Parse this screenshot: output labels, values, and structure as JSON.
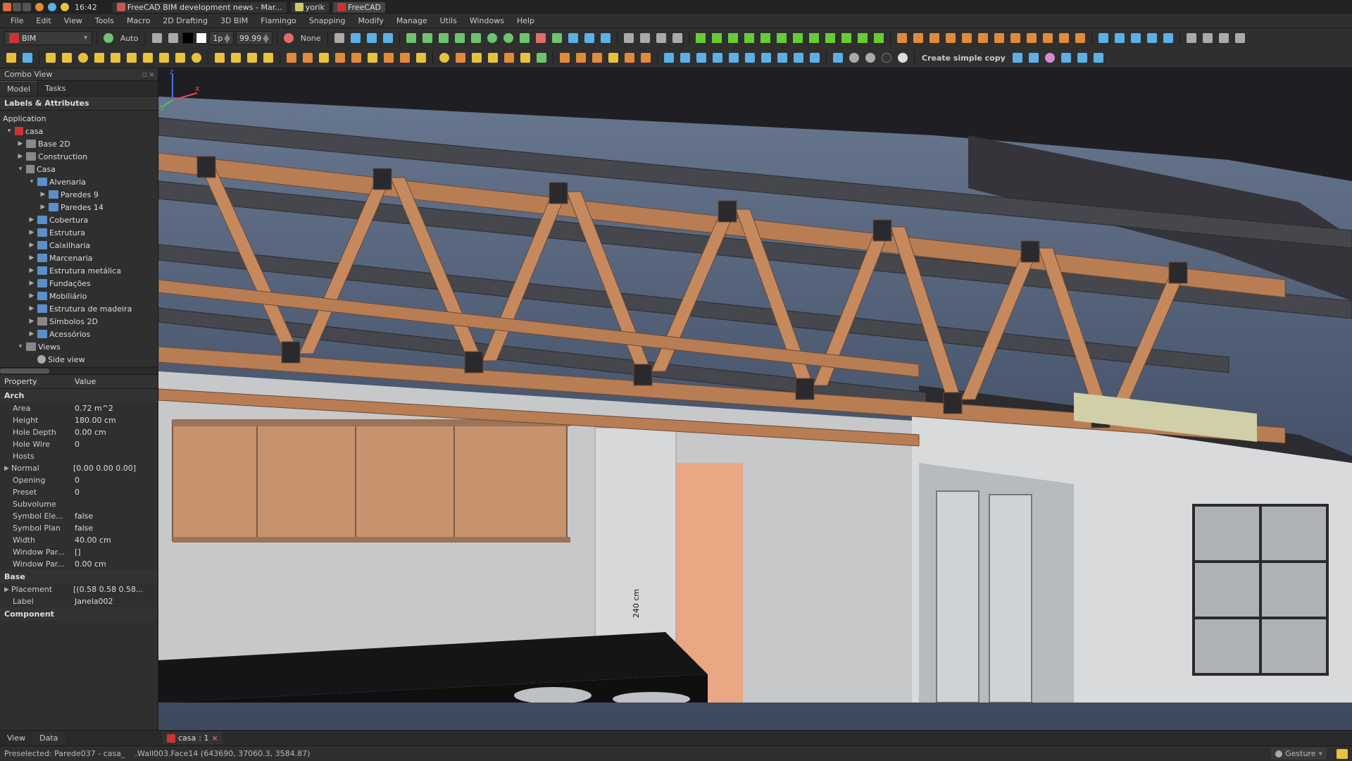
{
  "os": {
    "time": "16:42",
    "tasks": [
      {
        "label": "FreeCAD BIM development news - Mar...",
        "active": false
      },
      {
        "label": "yorik",
        "active": false
      },
      {
        "label": "FreeCAD",
        "active": true
      }
    ]
  },
  "menu": [
    "File",
    "Edit",
    "View",
    "Tools",
    "Macro",
    "2D Drafting",
    "3D BIM",
    "Flamingo",
    "Snapping",
    "Modify",
    "Manage",
    "Utils",
    "Windows",
    "Help"
  ],
  "tb1": {
    "workbench": "BIM",
    "auto": "Auto",
    "num1": "1p",
    "num2": "99.99",
    "linestyle": "None"
  },
  "tb2": {
    "btnLabel": "Create simple copy"
  },
  "combo": {
    "title": "Combo View",
    "tabs": [
      "Model",
      "Tasks"
    ],
    "labels": "Labels & Attributes",
    "app": "Application",
    "root": "casa",
    "tree": [
      {
        "d": 1,
        "exp": "▶",
        "cls": "fold",
        "t": "Base 2D"
      },
      {
        "d": 1,
        "exp": "▶",
        "cls": "fold",
        "t": "Construction"
      },
      {
        "d": 1,
        "exp": "▾",
        "cls": "cube",
        "t": "Casa"
      },
      {
        "d": 2,
        "exp": "▾",
        "cls": "fold blue",
        "t": "Alvenaria"
      },
      {
        "d": 3,
        "exp": "▶",
        "cls": "fold blue",
        "t": "Paredes 9"
      },
      {
        "d": 3,
        "exp": "▶",
        "cls": "fold blue",
        "t": "Paredes 14"
      },
      {
        "d": 2,
        "exp": "▶",
        "cls": "fold blue",
        "t": "Cobertura"
      },
      {
        "d": 2,
        "exp": "▶",
        "cls": "fold blue",
        "t": "Estrutura"
      },
      {
        "d": 2,
        "exp": "▶",
        "cls": "fold blue",
        "t": "Caixilharia"
      },
      {
        "d": 2,
        "exp": "▶",
        "cls": "fold blue",
        "t": "Marcenaria"
      },
      {
        "d": 2,
        "exp": "▶",
        "cls": "fold blue",
        "t": "Estrutura metálica"
      },
      {
        "d": 2,
        "exp": "▶",
        "cls": "fold blue",
        "t": "Fundações"
      },
      {
        "d": 2,
        "exp": "▶",
        "cls": "fold blue",
        "t": "Mobiliário"
      },
      {
        "d": 2,
        "exp": "▶",
        "cls": "fold blue",
        "t": "Estrutura de madeira"
      },
      {
        "d": 2,
        "exp": "▶",
        "cls": "fold",
        "t": "Símbolos 2D"
      },
      {
        "d": 2,
        "exp": "▶",
        "cls": "fold blue",
        "t": "Acessórios"
      },
      {
        "d": 1,
        "exp": "▾",
        "cls": "fold",
        "t": "Views"
      },
      {
        "d": 2,
        "exp": "",
        "cls": "gear",
        "t": "Side view"
      }
    ],
    "propHdr": {
      "c1": "Property",
      "c2": "Value"
    },
    "groups": {
      "arch": "Arch",
      "base": "Base",
      "comp": "Component"
    },
    "props": [
      {
        "n": "Area",
        "v": "0.72 m^2"
      },
      {
        "n": "Height",
        "v": "180.00 cm"
      },
      {
        "n": "Hole Depth",
        "v": "0.00 cm"
      },
      {
        "n": "Hole Wire",
        "v": "0"
      },
      {
        "n": "Hosts",
        "v": ""
      },
      {
        "n": "Normal",
        "v": "[0.00 0.00 0.00]",
        "exp": "▶"
      },
      {
        "n": "Opening",
        "v": "0"
      },
      {
        "n": "Preset",
        "v": "0"
      },
      {
        "n": "Subvolume",
        "v": ""
      },
      {
        "n": "Symbol Ele...",
        "v": "false"
      },
      {
        "n": "Symbol Plan",
        "v": "false"
      },
      {
        "n": "Width",
        "v": "40.00 cm"
      },
      {
        "n": "Window Par...",
        "v": "[]"
      },
      {
        "n": "Window Par...",
        "v": "0.00 cm"
      }
    ],
    "baseProps": [
      {
        "n": "Placement",
        "v": "[(0.58 0.58 0.58...",
        "exp": "▶"
      },
      {
        "n": "Label",
        "v": "Janela002"
      }
    ]
  },
  "botTabs": [
    "View",
    "Data"
  ],
  "doc": {
    "name": "casa",
    "count": ": 1"
  },
  "status": {
    "left": "Preselected: Parede037 - casa_",
    "mid": ".Wall003.Face14 (643690, 37060.3, 3584.87)",
    "gesture": "Gesture"
  },
  "viewport": {
    "dimension": "240 cm"
  }
}
